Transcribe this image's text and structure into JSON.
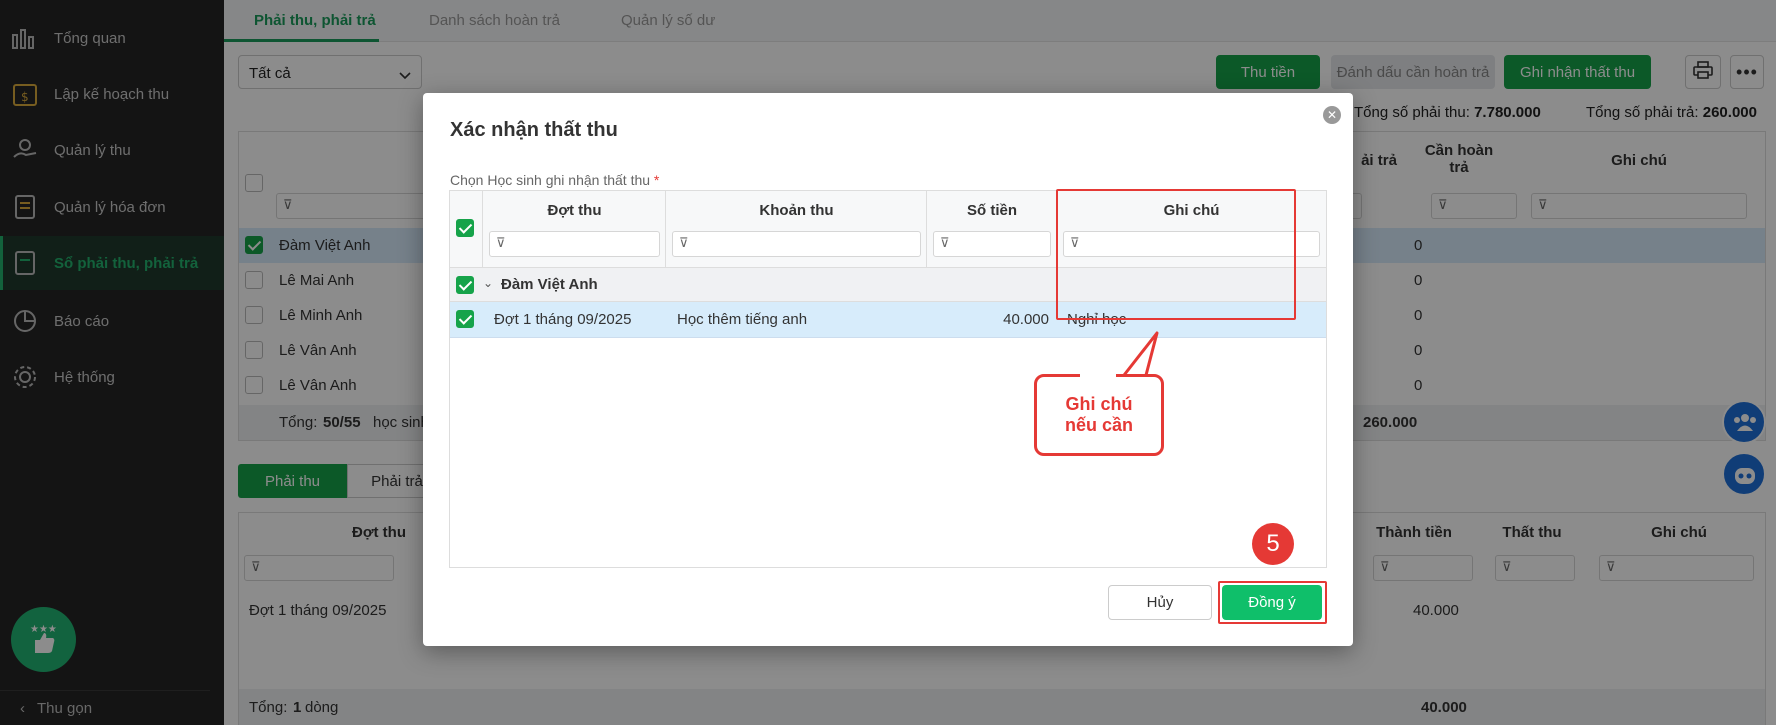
{
  "sidebar": {
    "items": [
      {
        "label": "Tổng quan",
        "icon": "chart-bars-icon"
      },
      {
        "label": "Lập kế hoạch thu",
        "icon": "calendar-money-icon"
      },
      {
        "label": "Quản lý thu",
        "icon": "hand-coin-icon"
      },
      {
        "label": "Quản lý hóa đơn",
        "icon": "invoice-icon"
      },
      {
        "label": "Sổ phải thu, phải trả",
        "icon": "ledger-book-icon",
        "active": true
      },
      {
        "label": "Báo cáo",
        "icon": "pie-chart-icon"
      },
      {
        "label": "Hệ thống",
        "icon": "gear-icon"
      }
    ],
    "collapse_label": "Thu gọn"
  },
  "tabs": [
    "Phải thu, phải trả",
    "Danh sách hoàn trả",
    "Quản lý số dư"
  ],
  "toolbar": {
    "filter_value": "Tất cả",
    "collect_label": "Thu tiền",
    "mark_refund_label": "Đánh dấu cần hoàn trả",
    "record_loss_label": "Ghi nhận thất thu"
  },
  "totals": {
    "receivable_label": "Tổng số phải thu:",
    "receivable_value": "7.780.000",
    "payable_label": "Tổng số phải trả:",
    "payable_value": "260.000"
  },
  "top_grid": {
    "headers": {
      "payable_suffix": "ải trả",
      "need_refund": "Cần hoàn trả",
      "note": "Ghi chú"
    },
    "rows": [
      {
        "name": "Đàm Việt Anh",
        "payable": "0",
        "checked": true
      },
      {
        "name": "Lê Mai Anh",
        "payable": "0",
        "checked": false
      },
      {
        "name": "Lê Minh Anh",
        "payable": "0",
        "checked": false
      },
      {
        "name": "Lê Vân Anh",
        "payable": "0",
        "checked": false
      },
      {
        "name": "Lê Vân Anh",
        "payable": "0",
        "checked": false
      }
    ],
    "footer_prefix": "Tổng:",
    "footer_count": "50/55",
    "footer_suffix": "học sinh",
    "footer_total": "260.000"
  },
  "bottom": {
    "tab_receivable": "Phải thu",
    "tab_payable": "Phải trả",
    "headers": {
      "period": "Đợt thu",
      "amount": "Thành tiền",
      "loss": "Thất thu",
      "note": "Ghi chú"
    },
    "row": {
      "period": "Đợt 1 tháng 09/2025",
      "amount": "40.000"
    },
    "footer_prefix": "Tổng:",
    "footer_count": "1",
    "footer_suffix": "dòng",
    "footer_total": "40.000"
  },
  "modal": {
    "title": "Xác nhận thất thu",
    "field_label": "Chọn Học sinh ghi nhận thất thu",
    "required_mark": "*",
    "headers": {
      "period": "Đợt thu",
      "item": "Khoản thu",
      "amount": "Số tiền",
      "note": "Ghi chú"
    },
    "group_name": "Đàm Việt Anh",
    "row": {
      "period": "Đợt 1 tháng 09/2025",
      "item": "Học thêm tiếng anh",
      "amount": "40.000",
      "note": "Nghỉ học"
    },
    "callout_line1": "Ghi chú",
    "callout_line2": "nếu cần",
    "step_number": "5",
    "cancel_label": "Hủy",
    "ok_label": "Đồng ý"
  },
  "colors": {
    "accent": "#16a34a",
    "highlight": "#e53935"
  }
}
